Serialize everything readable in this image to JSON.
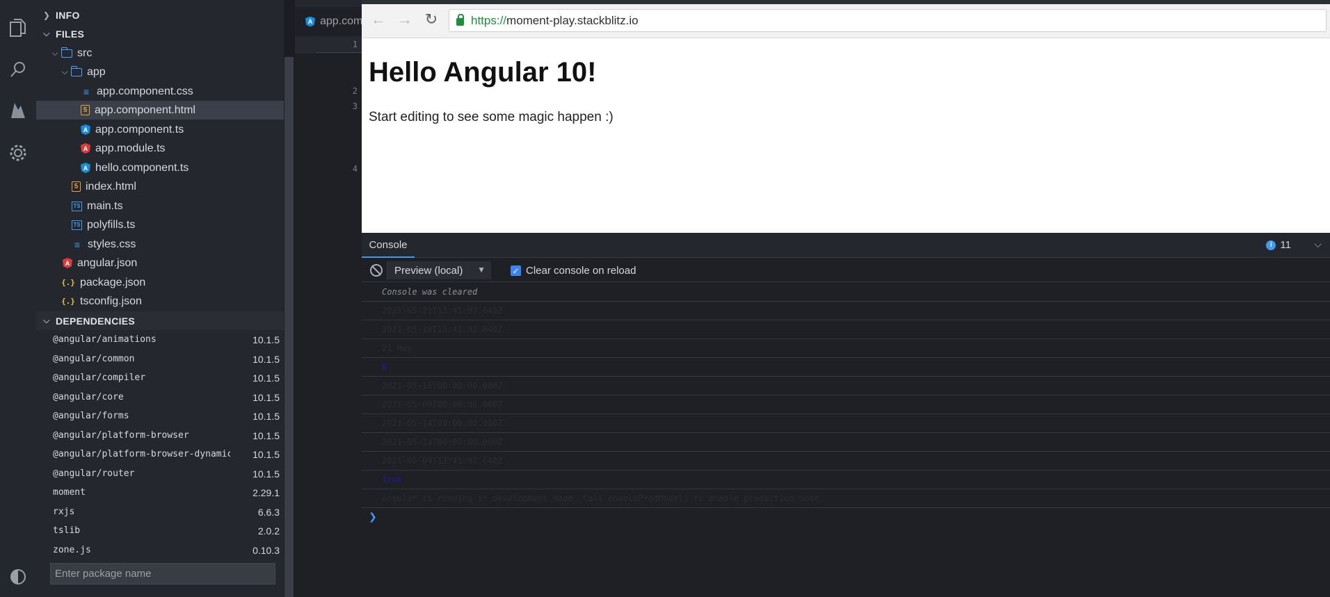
{
  "sidebar": {
    "info_header": "INFO",
    "files_header": "FILES",
    "dependencies_header": "DEPENDENCIES",
    "files": [
      {
        "label": "src",
        "type": "folder"
      },
      {
        "label": "app",
        "type": "folder"
      },
      {
        "label": "app.component.css",
        "type": "css"
      },
      {
        "label": "app.component.html",
        "type": "html"
      },
      {
        "label": "app.component.ts",
        "type": "angular"
      },
      {
        "label": "app.module.ts",
        "type": "angular-red"
      },
      {
        "label": "hello.component.ts",
        "type": "angular"
      },
      {
        "label": "index.html",
        "type": "html"
      },
      {
        "label": "main.ts",
        "type": "ts"
      },
      {
        "label": "polyfills.ts",
        "type": "ts"
      },
      {
        "label": "styles.css",
        "type": "css"
      },
      {
        "label": "angular.json",
        "type": "angular-red"
      },
      {
        "label": "package.json",
        "type": "json"
      },
      {
        "label": "tsconfig.json",
        "type": "json"
      }
    ],
    "dependencies": [
      {
        "name": "@angular/animations",
        "version": "10.1.5"
      },
      {
        "name": "@angular/common",
        "version": "10.1.5"
      },
      {
        "name": "@angular/compiler",
        "version": "10.1.5"
      },
      {
        "name": "@angular/core",
        "version": "10.1.5"
      },
      {
        "name": "@angular/forms",
        "version": "10.1.5"
      },
      {
        "name": "@angular/platform-browser",
        "version": "10.1.5"
      },
      {
        "name": "@angular/platform-browser-dynamic",
        "version": "10.1.5"
      },
      {
        "name": "@angular/router",
        "version": "10.1.5"
      },
      {
        "name": "moment",
        "version": "2.29.1"
      },
      {
        "name": "rxjs",
        "version": "6.6.3"
      },
      {
        "name": "tslib",
        "version": "2.0.2"
      },
      {
        "name": "zone.js",
        "version": "0.10.3"
      }
    ],
    "package_placeholder": "Enter package name"
  },
  "editor": {
    "tab_label": "app.com",
    "line_numbers": [
      "1",
      "2",
      "3",
      "4"
    ]
  },
  "browser": {
    "url_protocol": "https://",
    "url_host": "moment-play.stackblitz.io",
    "heading": "Hello Angular 10!",
    "paragraph": "Start editing to see some magic happen :)"
  },
  "console": {
    "tab_label": "Console",
    "info_count": "11",
    "context": "Preview (local)",
    "clear_on_reload": "Clear console on reload",
    "logs": [
      {
        "text": "Console was cleared",
        "style": "cleared"
      },
      {
        "text": "2021-05-21T13:41:02.640Z",
        "style": "normal"
      },
      {
        "text": "2021-05-19T13:41:02.640Z",
        "style": "normal"
      },
      {
        "text": "21 May",
        "style": "normal"
      },
      {
        "text": "6",
        "style": "blue"
      },
      {
        "text": "2021-05-16T00:00:00.000Z",
        "style": "normal"
      },
      {
        "text": "2021-05-09T00:00:00.000Z",
        "style": "normal"
      },
      {
        "text": "2021-05-14T00:00:00.000Z",
        "style": "normal"
      },
      {
        "text": "2021-05-14T00:00:00.000Z",
        "style": "normal"
      },
      {
        "text": "2021-06-04T13:41:02.640Z",
        "style": "normal"
      },
      {
        "text": "true",
        "style": "blue"
      },
      {
        "text": "Angular is running in development mode. Call enableProdMode() to enable production mode.",
        "style": "normal"
      }
    ]
  }
}
